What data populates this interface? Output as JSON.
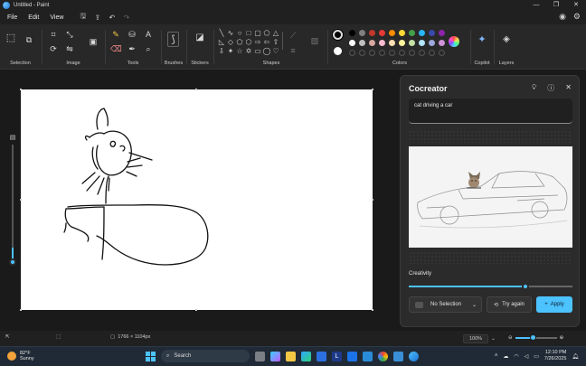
{
  "window": {
    "title": "Untitled - Paint",
    "controls": [
      "—",
      "❐",
      "✕"
    ]
  },
  "menu": {
    "items": [
      "File",
      "Edit",
      "View"
    ]
  },
  "ribbon": {
    "groups": {
      "selection": "Selection",
      "image": "Image",
      "tools": "Tools",
      "brushes": "Brushes",
      "stickers": "Stickers",
      "shapes": "Shapes",
      "colors": "Colors",
      "copilot": "Copilot",
      "layers": "Layers"
    },
    "palette_row1": [
      "#000000",
      "#808080",
      "#c0392b",
      "#e53935",
      "#fb8c00",
      "#fdd835",
      "#43a047",
      "#29b6f6",
      "#3949ab",
      "#8e24aa"
    ],
    "palette_row2": [
      "#ffffff",
      "#c0c0c0",
      "#d7a7a0",
      "#f8bbd0",
      "#ffe0b2",
      "#fff59d",
      "#c5e1a5",
      "#b3e5fc",
      "#9fa8da",
      "#ce93d8"
    ],
    "primary_color": "#000000",
    "secondary_color": "#ffffff"
  },
  "cocreator": {
    "title": "Cocreator",
    "prompt": "cat driving a car",
    "creativity_label": "Creativity",
    "creativity_level": 0.71,
    "selection_label": "No Selection",
    "try_again_label": "Try again",
    "apply_label": "Apply"
  },
  "status": {
    "canvas_size": "1766 × 1104px",
    "zoom": "100%"
  },
  "taskbar": {
    "temperature": "82°F",
    "condition": "Sunny",
    "search_label": "Search",
    "time": "12:10 PM",
    "date": "7/26/2025"
  },
  "colors": {
    "accent": "#4cc2ff",
    "panel": "#2b2b2b",
    "canvas_bg": "#ffffff"
  }
}
